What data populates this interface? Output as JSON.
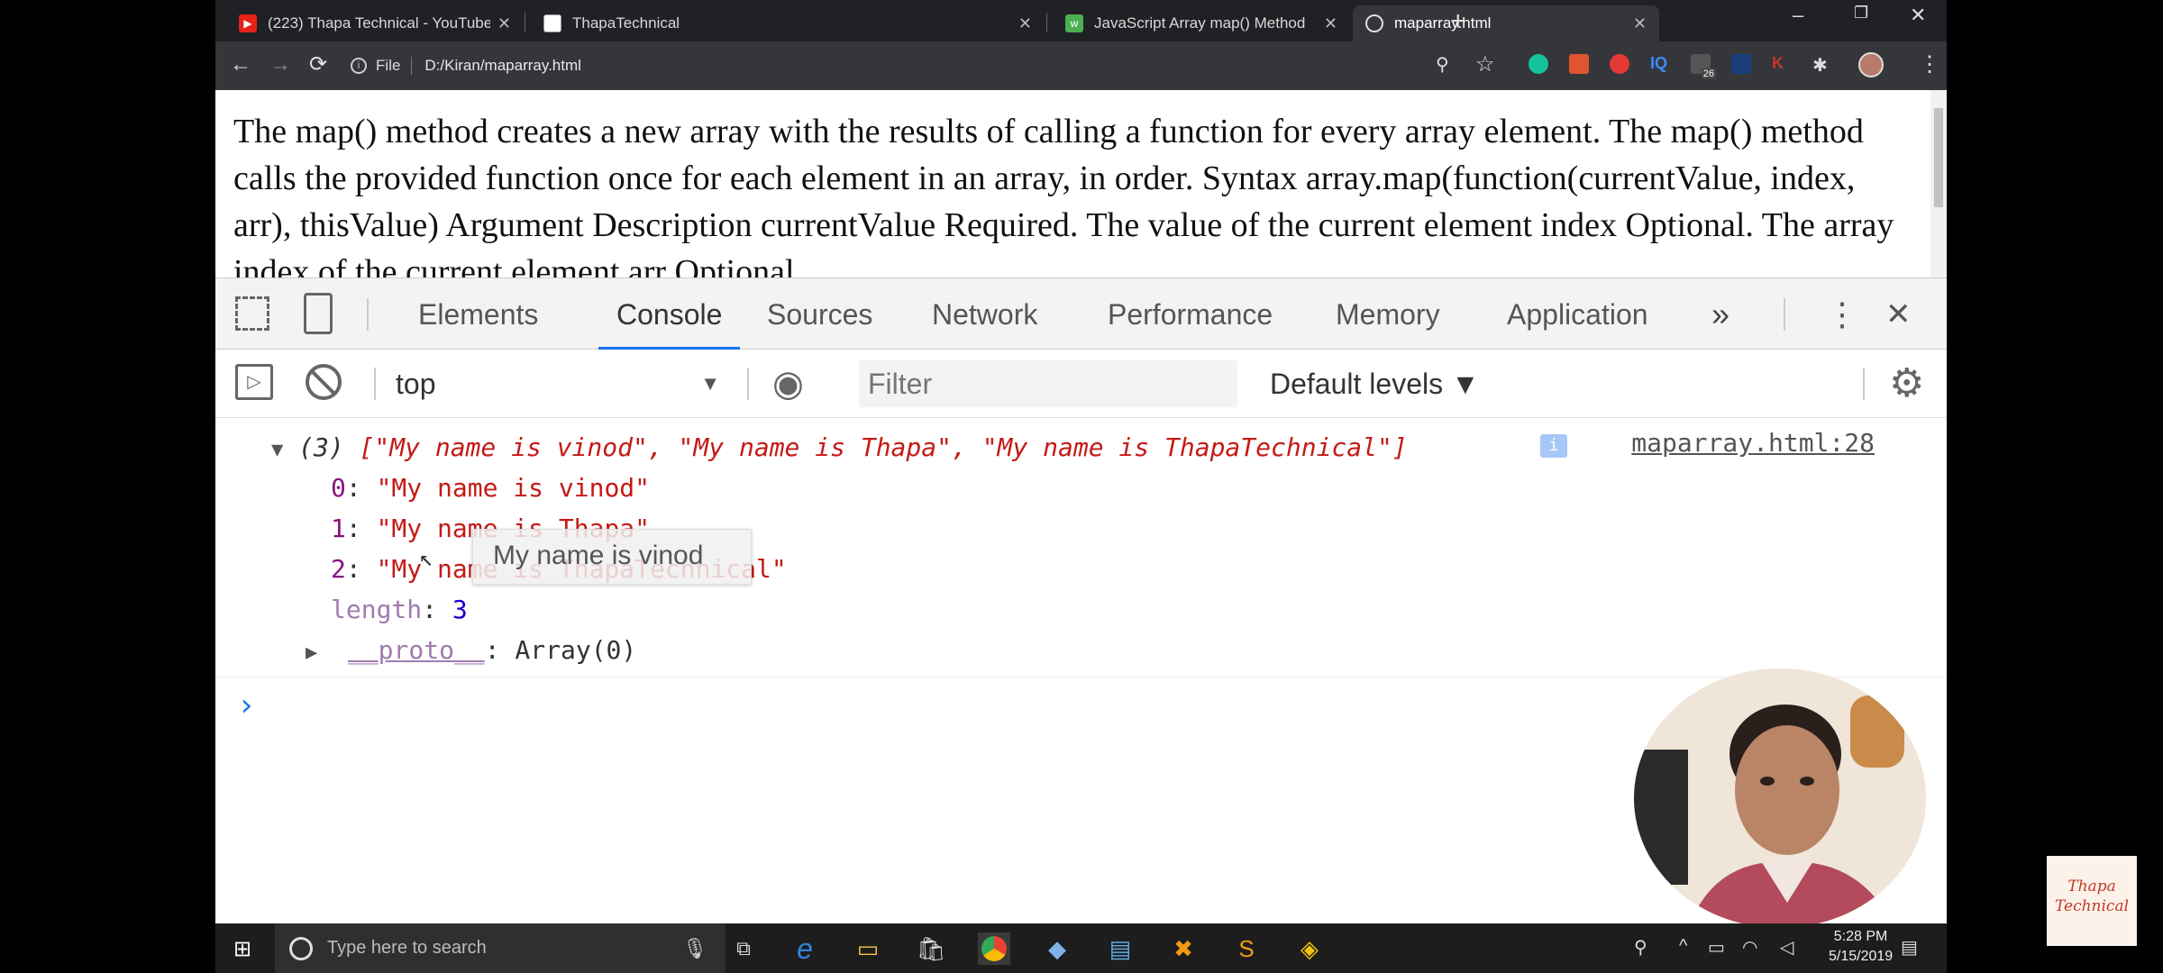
{
  "browser": {
    "tabs": [
      {
        "title": "(223) Thapa Technical - YouTube",
        "favicon": "youtube-icon"
      },
      {
        "title": "ThapaTechnical",
        "favicon": "page-icon"
      },
      {
        "title": "JavaScript Array map() Method",
        "favicon": "w3schools-icon"
      },
      {
        "title": "maparray.html",
        "favicon": "globe-icon"
      }
    ],
    "address": {
      "scheme_label": "File",
      "url": "D:/Kiran/maparray.html"
    },
    "extension_badge": "26"
  },
  "page": {
    "text": "The map() method creates a new array with the results of calling a function for every array element. The map() method calls the provided function once for each element in an array, in order. Syntax array.map(function(currentValue, index, arr), thisValue) Argument Description currentValue Required. The value of the current element index Optional. The array index of the current element arr Optional."
  },
  "devtools": {
    "tabs": [
      "Elements",
      "Console",
      "Sources",
      "Network",
      "Performance",
      "Memory",
      "Application"
    ],
    "active_tab": "Console",
    "more_label": "»",
    "context": "top",
    "filter_placeholder": "Filter",
    "levels_label": "Default levels ▼"
  },
  "console": {
    "summary_count": "(3)",
    "summary": "[\"My name is vinod\", \"My name is Thapa\", \"My name is ThapaTechnical\"]",
    "source": "maparray.html:28",
    "items": [
      {
        "index": "0",
        "value": "\"My name is vinod\""
      },
      {
        "index": "1",
        "value": "\"My name is Thapa\""
      },
      {
        "index": "2",
        "value": "\"My name is ThapaTechnical\""
      }
    ],
    "length_key": "length",
    "length_value": "3",
    "proto_key": "__proto__",
    "proto_value": "Array(0)",
    "tooltip": "My name is vinod",
    "prompt": "›"
  },
  "taskbar": {
    "search_placeholder": "Type here to search",
    "time": "5:28 PM",
    "date": "5/15/2019"
  },
  "watermark": "Thapa Technical"
}
